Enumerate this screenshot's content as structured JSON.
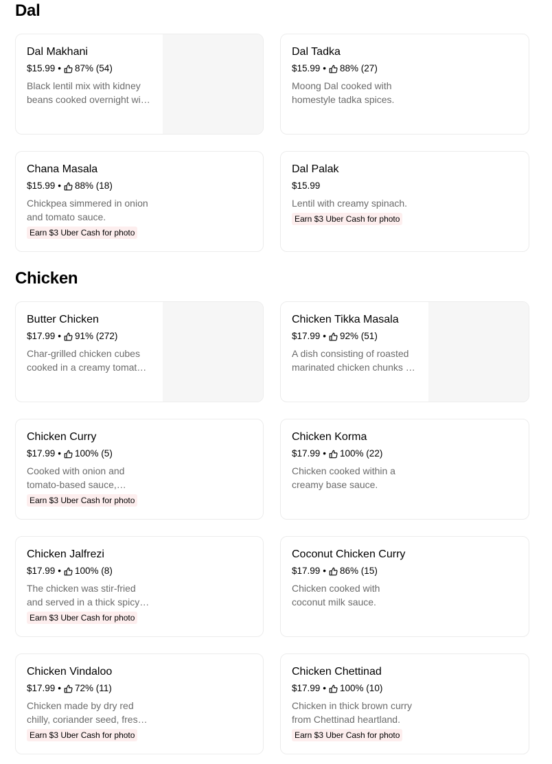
{
  "sections": {
    "dal": {
      "title": "Dal",
      "items": [
        {
          "name": "Dal Makhani",
          "price": "$15.99",
          "rating": "87% (54)",
          "description": "Black lentil mix with kidney beans cooked overnight with butter and cream.",
          "promo": "",
          "has_image": true
        },
        {
          "name": "Dal Tadka",
          "price": "$15.99",
          "rating": "88% (27)",
          "description": "Moong Dal cooked with homestyle tadka spices.",
          "promo": "",
          "has_image": false
        },
        {
          "name": "Chana Masala",
          "price": "$15.99",
          "rating": "88% (18)",
          "description": "Chickpea simmered in onion and tomato sauce.",
          "promo": "Earn $3 Uber Cash for photo",
          "has_image": false
        },
        {
          "name": "Dal Palak",
          "price": "$15.99",
          "rating": "",
          "description": "Lentil with creamy spinach.",
          "promo": "Earn $3 Uber Cash for photo",
          "has_image": false
        }
      ]
    },
    "chicken": {
      "title": "Chicken",
      "items": [
        {
          "name": "Butter Chicken",
          "price": "$17.99",
          "rating": "91% (272)",
          "description": "Char-grilled chicken cubes cooked in a creamy tomato sauce.",
          "promo": "",
          "has_image": true
        },
        {
          "name": "Chicken Tikka Masala",
          "price": "$17.99",
          "rating": "92% (51)",
          "description": "A dish consisting of roasted marinated chicken chunks in a spiced sauce.",
          "promo": "",
          "has_image": true
        },
        {
          "name": "Chicken Curry",
          "price": "$17.99",
          "rating": "100% (5)",
          "description": "Cooked with onion and tomato-based sauce, flavored with spices.",
          "promo": "Earn $3 Uber Cash for photo",
          "has_image": false
        },
        {
          "name": "Chicken Korma",
          "price": "$17.99",
          "rating": "100% (22)",
          "description": "Chicken cooked within a creamy base sauce.",
          "promo": "",
          "has_image": false
        },
        {
          "name": "Chicken Jalfrezi",
          "price": "$17.99",
          "rating": "100% (8)",
          "description": "The chicken was stir-fried and served in a thick spicy sauce.",
          "promo": "Earn $3 Uber Cash for photo",
          "has_image": false
        },
        {
          "name": "Coconut Chicken Curry",
          "price": "$17.99",
          "rating": "86% (15)",
          "description": "Chicken cooked with coconut milk sauce.",
          "promo": "",
          "has_image": false
        },
        {
          "name": "Chicken Vindaloo",
          "price": "$17.99",
          "rating": "72% (11)",
          "description": "Chicken made by dry red chilly, coriander seed, fresh garlic and ginger.",
          "promo": "Earn $3 Uber Cash for photo",
          "has_image": false
        },
        {
          "name": "Chicken Chettinad",
          "price": "$17.99",
          "rating": "100% (10)",
          "description": "Chicken in thick brown curry from Chettinad heartland.",
          "promo": "Earn $3 Uber Cash for photo",
          "has_image": false
        }
      ]
    }
  },
  "rating_icon": "thumbs-up-icon",
  "separator": "•",
  "colors": {
    "promo_bg": "#fdeeee",
    "description": "#6b6b6b",
    "card_border": "#ececec",
    "image_placeholder": "#f6f6f6"
  }
}
